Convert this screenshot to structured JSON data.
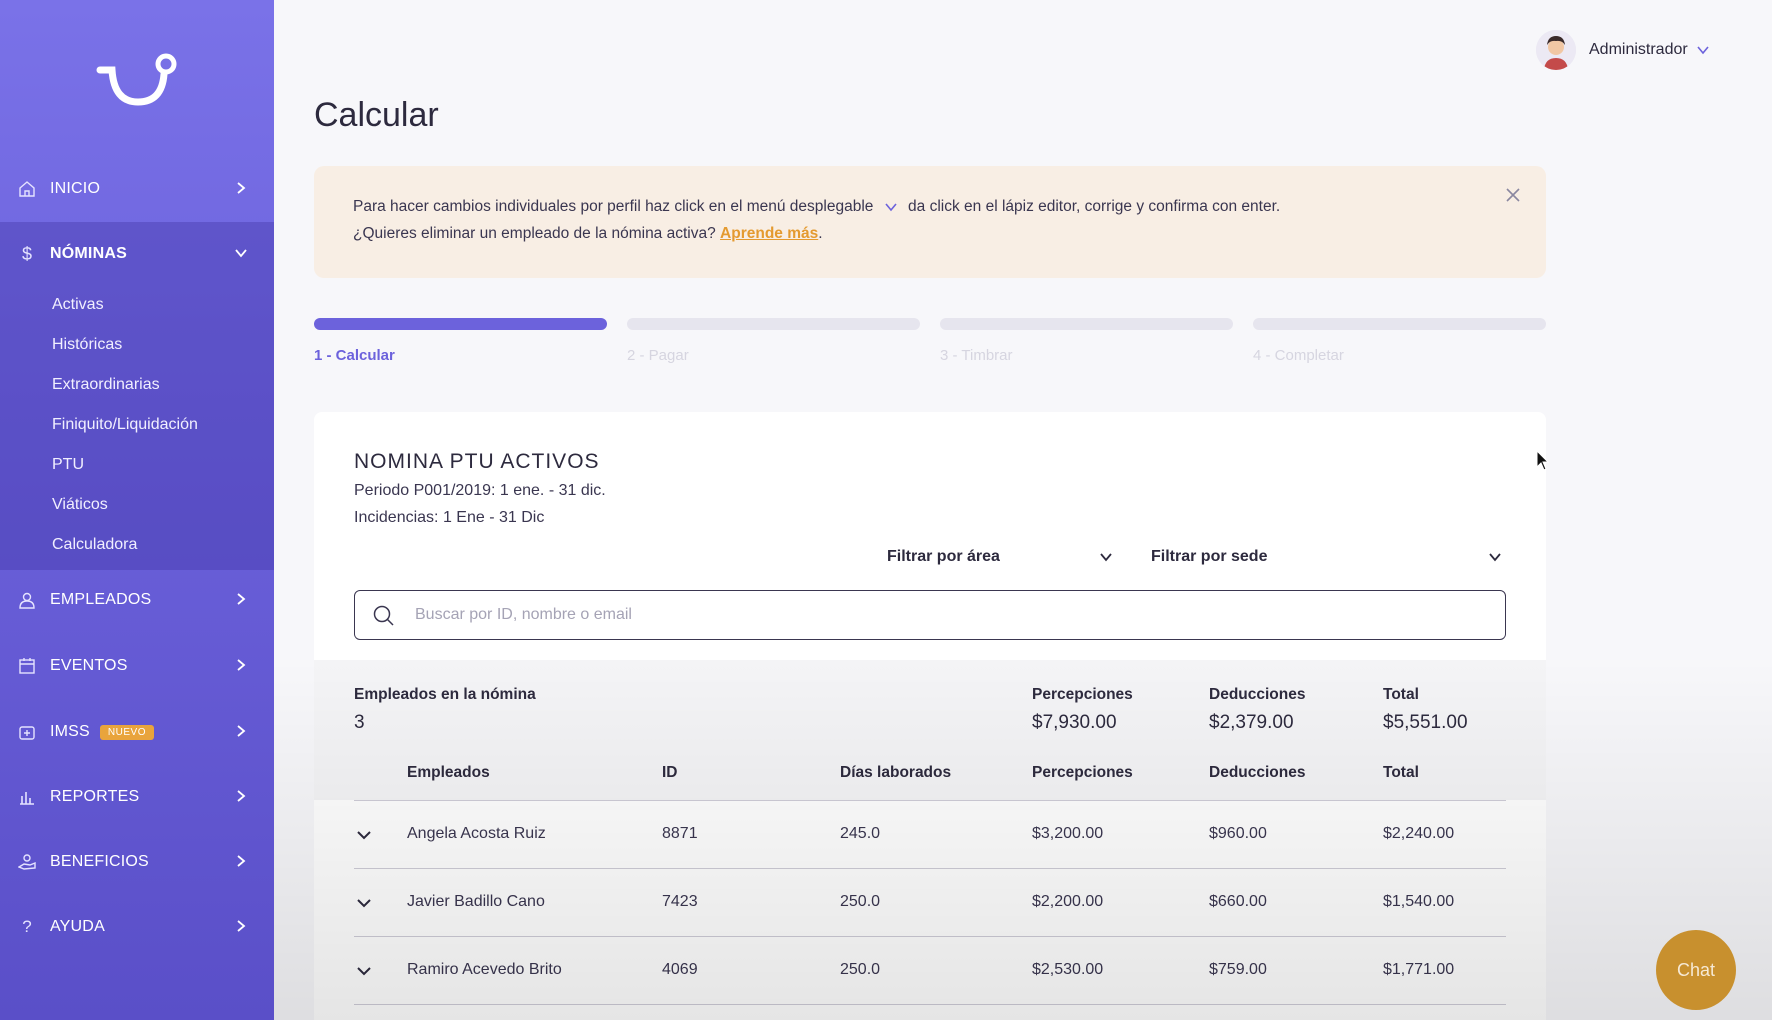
{
  "sidebar": {
    "logo_icon": "brand-logo-icon",
    "items": [
      {
        "label": "INICIO",
        "icon": "home-icon"
      },
      {
        "label": "NÓMINAS",
        "icon": "dollar-icon"
      },
      {
        "label": "EMPLEADOS",
        "icon": "user-icon"
      },
      {
        "label": "EVENTOS",
        "icon": "calendar-icon"
      },
      {
        "label": "IMSS",
        "icon": "medical-icon",
        "badge": "NUEVO"
      },
      {
        "label": "REPORTES",
        "icon": "chart-icon"
      },
      {
        "label": "BENEFICIOS",
        "icon": "hand-icon"
      },
      {
        "label": "AYUDA",
        "icon": "question-icon"
      }
    ],
    "nominas_sub": [
      "Activas",
      "Históricas",
      "Extraordinarias",
      "Finiquito/Liquidación",
      "PTU",
      "Viáticos",
      "Calculadora"
    ]
  },
  "header": {
    "user_name": "Administrador"
  },
  "page": {
    "title": "Calcular"
  },
  "banner": {
    "line1_a": "Para hacer cambios individuales por perfil haz click en el menú desplegable",
    "line1_b": "da click en el lápiz editor, corrige y confirma con enter.",
    "line2": "¿Quieres eliminar un empleado de la nómina activa?",
    "link": "Aprende más",
    "line2_end": "."
  },
  "steps": [
    "1 - Calcular",
    "2 - Pagar",
    "3 - Timbrar",
    "4 - Completar"
  ],
  "card": {
    "title": "NOMINA PTU ACTIVOS",
    "periodo": "Periodo P001/2019: 1 ene. - 31 dic.",
    "incidencias": "Incidencias: 1 Ene - 31 Dic",
    "filter_area": "Filtrar por área",
    "filter_sede": "Filtrar por sede",
    "search_placeholder": "Buscar por ID, nombre o email"
  },
  "summary": {
    "empleados_label": "Empleados en la nómina",
    "empleados_value": "3",
    "percepciones_label": "Percepciones",
    "percepciones_value": "$7,930.00",
    "deducciones_label": "Deducciones",
    "deducciones_value": "$2,379.00",
    "total_label": "Total",
    "total_value": "$5,551.00"
  },
  "table": {
    "columns": [
      "Empleados",
      "ID",
      "Días laborados",
      "Percepciones",
      "Deducciones",
      "Total"
    ],
    "rows": [
      [
        "Angela Acosta Ruiz",
        "8871",
        "245.0",
        "$3,200.00",
        "$960.00",
        "$2,240.00"
      ],
      [
        "Javier Badillo Cano",
        "7423",
        "250.0",
        "$2,200.00",
        "$660.00",
        "$1,540.00"
      ],
      [
        "Ramiro Acevedo Brito",
        "4069",
        "250.0",
        "$2,530.00",
        "$759.00",
        "$1,771.00"
      ]
    ]
  },
  "chat": {
    "label": "Chat"
  },
  "colors": {
    "primary": "#6c62dc",
    "accent": "#e49a2f",
    "banner_bg": "#f8eee4",
    "chat": "#c8902e"
  }
}
